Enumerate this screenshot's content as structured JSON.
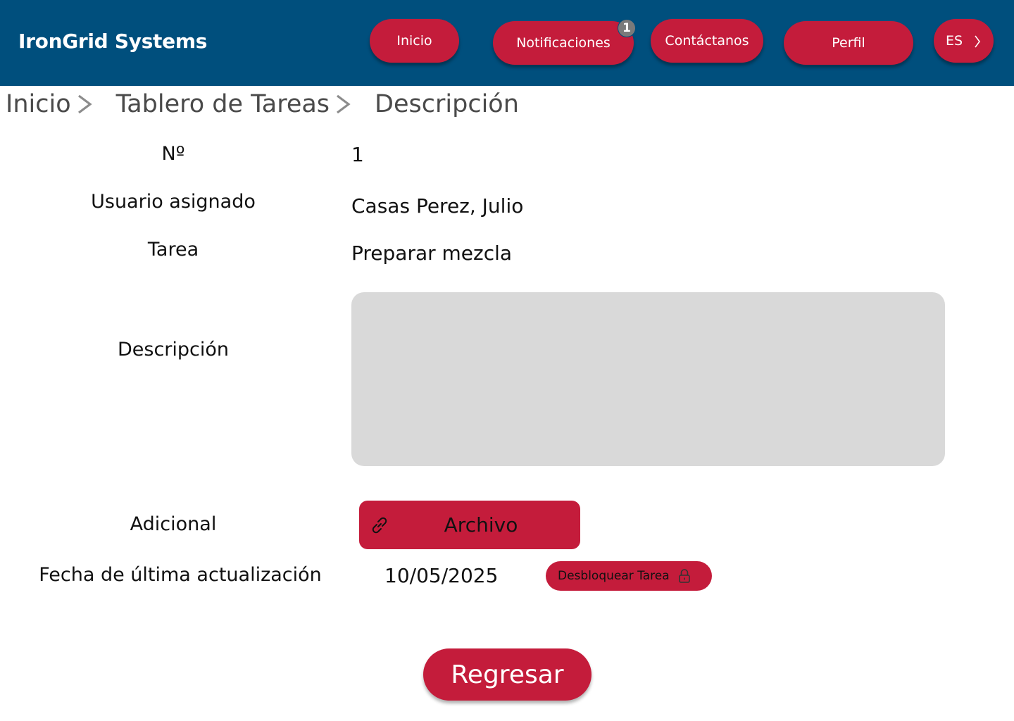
{
  "header": {
    "brand": "IronGrid Systems",
    "nav": {
      "inicio": "Inicio",
      "notificaciones": "Notificaciones",
      "notificaciones_count": "1",
      "contactanos": "Contáctanos",
      "perfil": "Perfil",
      "language": "ES"
    }
  },
  "breadcrumb": {
    "items": [
      "Inicio",
      "Tablero de Tareas",
      "Descripción"
    ]
  },
  "task": {
    "number_label": "Nº",
    "number_value": "1",
    "user_label": "Usuario asignado",
    "user_value": "Casas Perez, Julio",
    "task_label": "Tarea",
    "task_value": "Preparar mezcla",
    "description_label": "Descripción",
    "description_value": "",
    "additional_label": "Adicional",
    "file_button": "Archivo",
    "updated_label": "Fecha de última actualización",
    "updated_value": "10/05/2025",
    "unlock_button": "Desbloquear Tarea"
  },
  "footer": {
    "back_button": "Regresar"
  },
  "icons": {
    "file": "link-icon",
    "unlock": "lock-icon",
    "language": "chevron-right-icon",
    "breadcrumb_separator": "chevron-right-icon"
  },
  "colors": {
    "header_bg": "#004f7d",
    "accent": "#c41c3b",
    "description_bg": "#d9d9d9",
    "badge": "#7a7a7a"
  }
}
